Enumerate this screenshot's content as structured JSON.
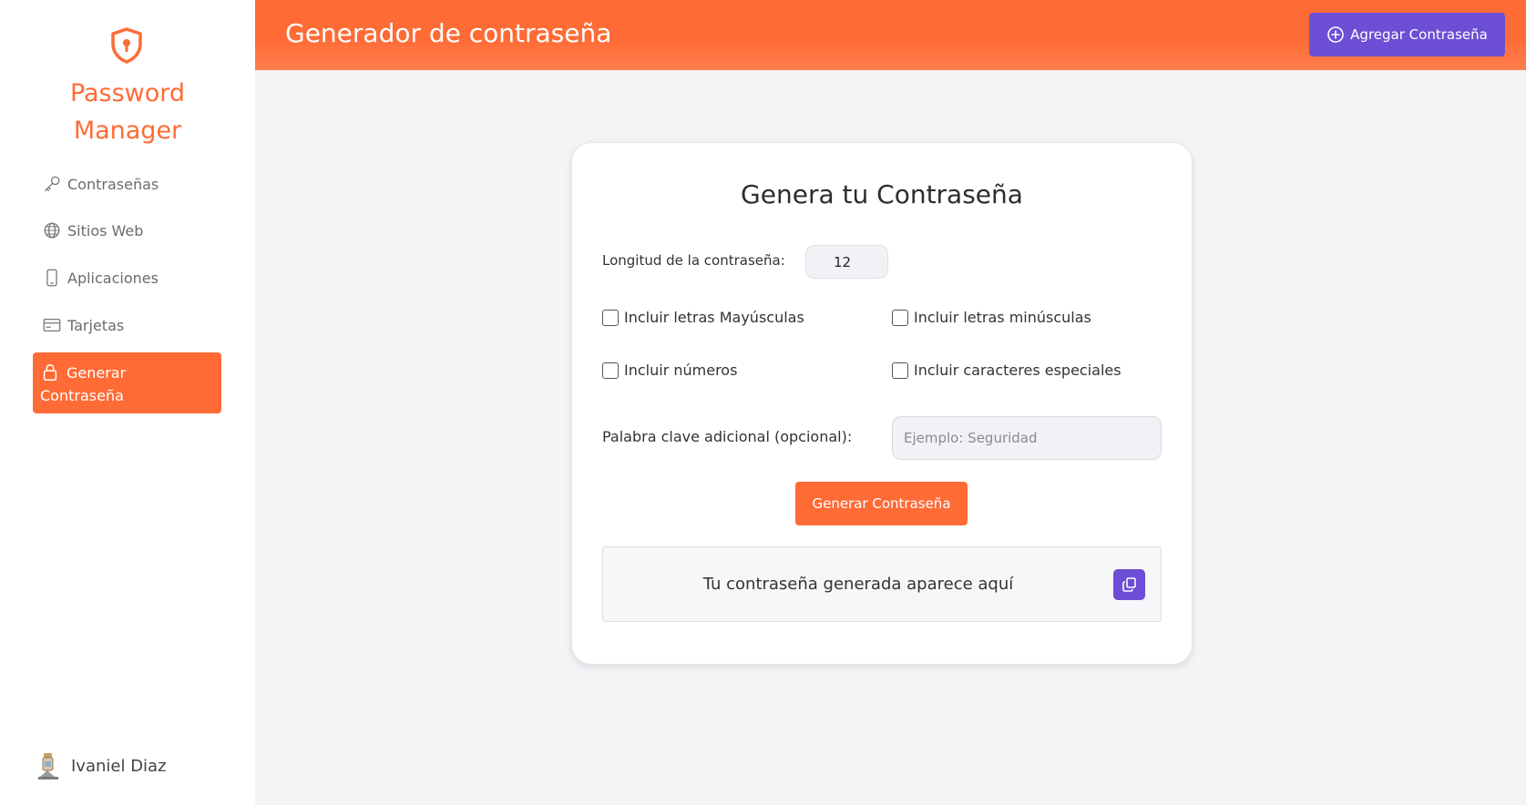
{
  "sidebar": {
    "brand_line1": "Password",
    "brand_line2": "Manager",
    "items": [
      {
        "label": "Contraseñas",
        "icon": "key-icon"
      },
      {
        "label": "Sitios Web",
        "icon": "globe-icon"
      },
      {
        "label": "Aplicaciones",
        "icon": "phone-icon"
      },
      {
        "label": "Tarjetas",
        "icon": "card-icon"
      },
      {
        "label": "Generar Contraseña",
        "icon": "lock-icon",
        "active": true
      }
    ],
    "user_name": "Ivaniel Diaz"
  },
  "header": {
    "title": "Generador de contraseña",
    "add_button_label": "Agregar Contraseña"
  },
  "card": {
    "title": "Genera tu Contraseña",
    "length_label": "Longitud de la contraseña:",
    "length_value": "12",
    "checkboxes": {
      "uppercase": "Incluir letras Mayúsculas",
      "lowercase": "Incluir letras minúsculas",
      "numbers": "Incluir números",
      "special": "Incluir caracteres especiales"
    },
    "keyword_label": "Palabra clave adicional (opcional):",
    "keyword_placeholder": "Ejemplo: Seguridad",
    "generate_button": "Generar Contraseña",
    "result_placeholder": "Tu contraseña generada aparece aquí"
  },
  "colors": {
    "accent": "#ff6b35",
    "secondary": "#6c4fd4",
    "background": "#f4f4f7"
  }
}
